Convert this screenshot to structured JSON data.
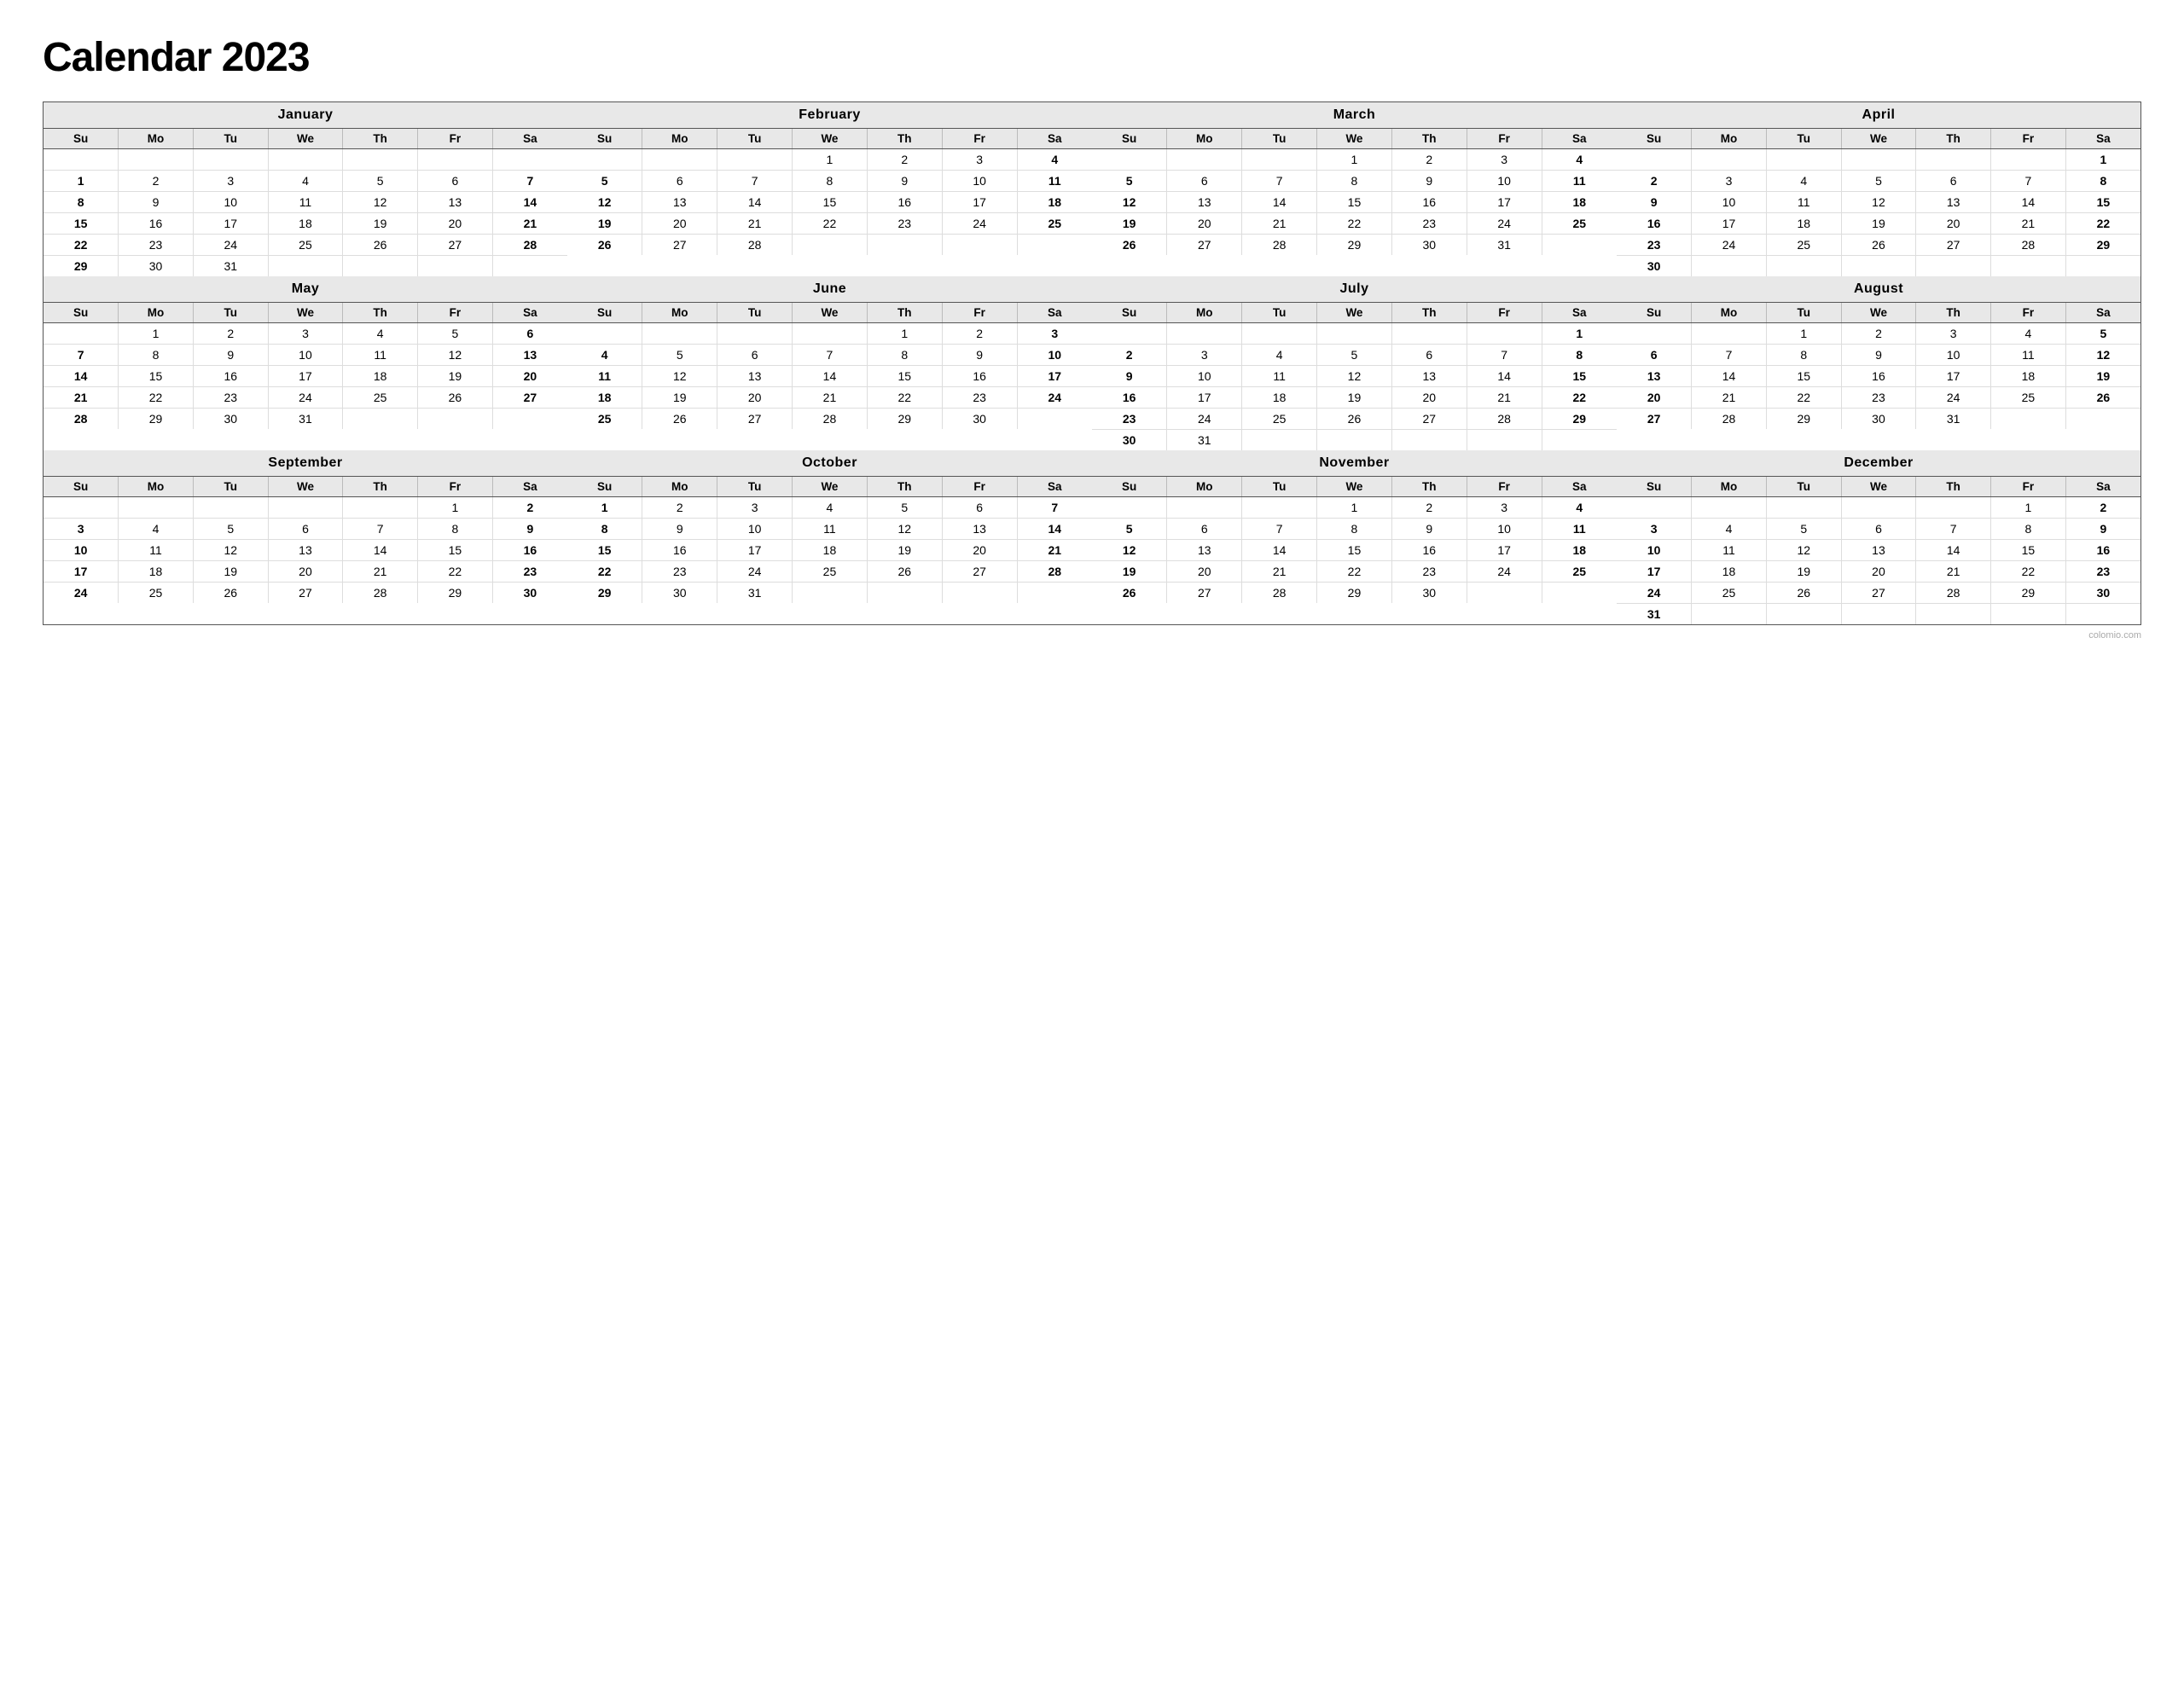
{
  "title": "Calendar 2023",
  "watermark": "colomio.com",
  "days_header": [
    "Su",
    "Mo",
    "Tu",
    "We",
    "Th",
    "Fr",
    "Sa"
  ],
  "months": [
    {
      "name": "January",
      "weeks": [
        [
          "",
          "",
          "",
          "",
          "",
          "",
          ""
        ],
        [
          "1",
          "2",
          "3",
          "4",
          "5",
          "6",
          "7"
        ],
        [
          "8",
          "9",
          "10",
          "11",
          "12",
          "13",
          "14"
        ],
        [
          "15",
          "16",
          "17",
          "18",
          "19",
          "20",
          "21"
        ],
        [
          "22",
          "23",
          "24",
          "25",
          "26",
          "27",
          "28"
        ],
        [
          "29",
          "30",
          "31",
          "",
          "",
          "",
          ""
        ]
      ]
    },
    {
      "name": "February",
      "weeks": [
        [
          "",
          "",
          "",
          "1",
          "2",
          "3",
          "4"
        ],
        [
          "5",
          "6",
          "7",
          "8",
          "9",
          "10",
          "11"
        ],
        [
          "12",
          "13",
          "14",
          "15",
          "16",
          "17",
          "18"
        ],
        [
          "19",
          "20",
          "21",
          "22",
          "23",
          "24",
          "25"
        ],
        [
          "26",
          "27",
          "28",
          "",
          "",
          "",
          ""
        ],
        [
          "",
          "",
          "",
          "",
          "",
          "",
          ""
        ]
      ]
    },
    {
      "name": "March",
      "weeks": [
        [
          "",
          "",
          "",
          "1",
          "2",
          "3",
          "4"
        ],
        [
          "5",
          "6",
          "7",
          "8",
          "9",
          "10",
          "11"
        ],
        [
          "12",
          "13",
          "14",
          "15",
          "16",
          "17",
          "18"
        ],
        [
          "19",
          "20",
          "21",
          "22",
          "23",
          "24",
          "25"
        ],
        [
          "26",
          "27",
          "28",
          "29",
          "30",
          "31",
          ""
        ],
        [
          "",
          "",
          "",
          "",
          "",
          "",
          ""
        ]
      ]
    },
    {
      "name": "April",
      "weeks": [
        [
          "",
          "",
          "",
          "",
          "",
          "",
          "1"
        ],
        [
          "2",
          "3",
          "4",
          "5",
          "6",
          "7",
          "8"
        ],
        [
          "9",
          "10",
          "11",
          "12",
          "13",
          "14",
          "15"
        ],
        [
          "16",
          "17",
          "18",
          "19",
          "20",
          "21",
          "22"
        ],
        [
          "23",
          "24",
          "25",
          "26",
          "27",
          "28",
          "29"
        ],
        [
          "30",
          "",
          "",
          "",
          "",
          "",
          ""
        ]
      ]
    },
    {
      "name": "May",
      "weeks": [
        [
          "",
          "1",
          "2",
          "3",
          "4",
          "5",
          "6"
        ],
        [
          "7",
          "8",
          "9",
          "10",
          "11",
          "12",
          "13"
        ],
        [
          "14",
          "15",
          "16",
          "17",
          "18",
          "19",
          "20"
        ],
        [
          "21",
          "22",
          "23",
          "24",
          "25",
          "26",
          "27"
        ],
        [
          "28",
          "29",
          "30",
          "31",
          "",
          "",
          ""
        ],
        [
          "",
          "",
          "",
          "",
          "",
          "",
          ""
        ]
      ]
    },
    {
      "name": "June",
      "weeks": [
        [
          "",
          "",
          "",
          "",
          "1",
          "2",
          "3"
        ],
        [
          "4",
          "5",
          "6",
          "7",
          "8",
          "9",
          "10"
        ],
        [
          "11",
          "12",
          "13",
          "14",
          "15",
          "16",
          "17"
        ],
        [
          "18",
          "19",
          "20",
          "21",
          "22",
          "23",
          "24"
        ],
        [
          "25",
          "26",
          "27",
          "28",
          "29",
          "30",
          ""
        ],
        [
          "",
          "",
          "",
          "",
          "",
          "",
          ""
        ]
      ]
    },
    {
      "name": "July",
      "weeks": [
        [
          "",
          "",
          "",
          "",
          "",
          "",
          "1"
        ],
        [
          "2",
          "3",
          "4",
          "5",
          "6",
          "7",
          "8"
        ],
        [
          "9",
          "10",
          "11",
          "12",
          "13",
          "14",
          "15"
        ],
        [
          "16",
          "17",
          "18",
          "19",
          "20",
          "21",
          "22"
        ],
        [
          "23",
          "24",
          "25",
          "26",
          "27",
          "28",
          "29"
        ],
        [
          "30",
          "31",
          "",
          "",
          "",
          "",
          ""
        ]
      ]
    },
    {
      "name": "August",
      "weeks": [
        [
          "",
          "",
          "1",
          "2",
          "3",
          "4",
          "5"
        ],
        [
          "6",
          "7",
          "8",
          "9",
          "10",
          "11",
          "12"
        ],
        [
          "13",
          "14",
          "15",
          "16",
          "17",
          "18",
          "19"
        ],
        [
          "20",
          "21",
          "22",
          "23",
          "24",
          "25",
          "26"
        ],
        [
          "27",
          "28",
          "29",
          "30",
          "31",
          "",
          ""
        ],
        [
          "",
          "",
          "",
          "",
          "",
          "",
          ""
        ]
      ]
    },
    {
      "name": "September",
      "weeks": [
        [
          "",
          "",
          "",
          "",
          "",
          "1",
          "2"
        ],
        [
          "3",
          "4",
          "5",
          "6",
          "7",
          "8",
          "9"
        ],
        [
          "10",
          "11",
          "12",
          "13",
          "14",
          "15",
          "16"
        ],
        [
          "17",
          "18",
          "19",
          "20",
          "21",
          "22",
          "23"
        ],
        [
          "24",
          "25",
          "26",
          "27",
          "28",
          "29",
          "30"
        ],
        [
          "",
          "",
          "",
          "",
          "",
          "",
          ""
        ]
      ]
    },
    {
      "name": "October",
      "weeks": [
        [
          "1",
          "2",
          "3",
          "4",
          "5",
          "6",
          "7"
        ],
        [
          "8",
          "9",
          "10",
          "11",
          "12",
          "13",
          "14"
        ],
        [
          "15",
          "16",
          "17",
          "18",
          "19",
          "20",
          "21"
        ],
        [
          "22",
          "23",
          "24",
          "25",
          "26",
          "27",
          "28"
        ],
        [
          "29",
          "30",
          "31",
          "",
          "",
          "",
          ""
        ],
        [
          "",
          "",
          "",
          "",
          "",
          "",
          ""
        ]
      ]
    },
    {
      "name": "November",
      "weeks": [
        [
          "",
          "",
          "",
          "1",
          "2",
          "3",
          "4"
        ],
        [
          "5",
          "6",
          "7",
          "8",
          "9",
          "10",
          "11"
        ],
        [
          "12",
          "13",
          "14",
          "15",
          "16",
          "17",
          "18"
        ],
        [
          "19",
          "20",
          "21",
          "22",
          "23",
          "24",
          "25"
        ],
        [
          "26",
          "27",
          "28",
          "29",
          "30",
          "",
          ""
        ],
        [
          "",
          "",
          "",
          "",
          "",
          "",
          ""
        ]
      ]
    },
    {
      "name": "December",
      "weeks": [
        [
          "",
          "",
          "",
          "",
          "",
          "1",
          "2"
        ],
        [
          "3",
          "4",
          "5",
          "6",
          "7",
          "8",
          "9"
        ],
        [
          "10",
          "11",
          "12",
          "13",
          "14",
          "15",
          "16"
        ],
        [
          "17",
          "18",
          "19",
          "20",
          "21",
          "22",
          "23"
        ],
        [
          "24",
          "25",
          "26",
          "27",
          "28",
          "29",
          "30"
        ],
        [
          "31",
          "",
          "",
          "",
          "",
          "",
          ""
        ]
      ]
    }
  ]
}
